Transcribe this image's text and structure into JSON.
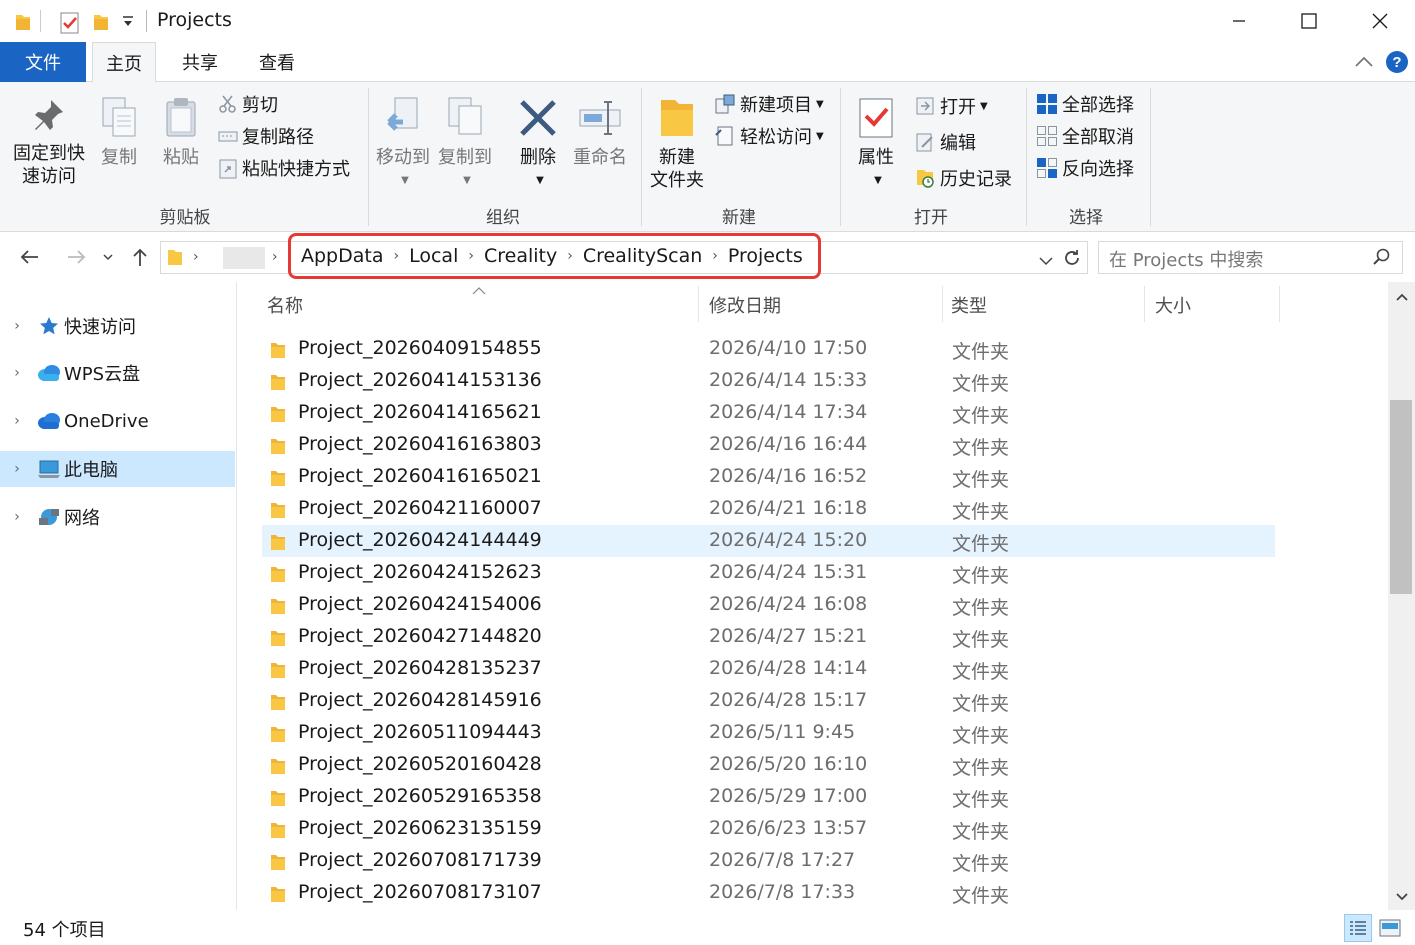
{
  "window": {
    "title": "Projects"
  },
  "ribbon_tabs": [
    "文件",
    "主页",
    "共享",
    "查看"
  ],
  "ribbon": {
    "clipboard": {
      "group": "剪贴板",
      "pin_line1": "固定到快",
      "pin_line2": "速访问",
      "copy": "复制",
      "paste": "粘贴",
      "cut": "剪切",
      "copy_path": "复制路径",
      "paste_shortcut": "粘贴快捷方式"
    },
    "organize": {
      "group": "组织",
      "move_to": "移动到",
      "copy_to": "复制到",
      "delete": "删除",
      "rename": "重命名"
    },
    "new": {
      "group": "新建",
      "new_folder_line1": "新建",
      "new_folder_line2": "文件夹",
      "new_item": "新建项目",
      "easy_access": "轻松访问"
    },
    "open": {
      "group": "打开",
      "properties": "属性",
      "open": "打开",
      "edit": "编辑",
      "history": "历史记录"
    },
    "select": {
      "group": "选择",
      "select_all": "全部选择",
      "select_none": "全部取消",
      "invert": "反向选择"
    }
  },
  "address": {
    "breadcrumbs": [
      "AppData",
      "Local",
      "Creality",
      "CrealityScan",
      "Projects"
    ],
    "search_placeholder": "在 Projects 中搜索"
  },
  "nav_pane": [
    {
      "label": "快速访问",
      "icon": "star-icon"
    },
    {
      "label": "WPS云盘",
      "icon": "cloud-icon"
    },
    {
      "label": "OneDrive",
      "icon": "onedrive-icon"
    },
    {
      "label": "此电脑",
      "icon": "computer-icon",
      "selected": true
    },
    {
      "label": "网络",
      "icon": "network-icon"
    }
  ],
  "columns": [
    "名称",
    "修改日期",
    "类型",
    "大小"
  ],
  "files": [
    {
      "name": "Project_20260409154855",
      "date": "2026/4/10 17:50",
      "type": "文件夹"
    },
    {
      "name": "Project_20260414153136",
      "date": "2026/4/14 15:33",
      "type": "文件夹"
    },
    {
      "name": "Project_20260414165621",
      "date": "2026/4/14 17:34",
      "type": "文件夹"
    },
    {
      "name": "Project_20260416163803",
      "date": "2026/4/16 16:44",
      "type": "文件夹"
    },
    {
      "name": "Project_20260416165021",
      "date": "2026/4/16 16:52",
      "type": "文件夹"
    },
    {
      "name": "Project_20260421160007",
      "date": "2026/4/21 16:18",
      "type": "文件夹"
    },
    {
      "name": "Project_20260424144449",
      "date": "2026/4/24 15:20",
      "type": "文件夹",
      "selected": true
    },
    {
      "name": "Project_20260424152623",
      "date": "2026/4/24 15:31",
      "type": "文件夹"
    },
    {
      "name": "Project_20260424154006",
      "date": "2026/4/24 16:08",
      "type": "文件夹"
    },
    {
      "name": "Project_20260427144820",
      "date": "2026/4/27 15:21",
      "type": "文件夹"
    },
    {
      "name": "Project_20260428135237",
      "date": "2026/4/28 14:14",
      "type": "文件夹"
    },
    {
      "name": "Project_20260428145916",
      "date": "2026/4/28 15:17",
      "type": "文件夹"
    },
    {
      "name": "Project_20260511094443",
      "date": "2026/5/11 9:45",
      "type": "文件夹"
    },
    {
      "name": "Project_20260520160428",
      "date": "2026/5/20 16:10",
      "type": "文件夹"
    },
    {
      "name": "Project_20260529165358",
      "date": "2026/5/29 17:00",
      "type": "文件夹"
    },
    {
      "name": "Project_20260623135159",
      "date": "2026/6/23 13:57",
      "type": "文件夹"
    },
    {
      "name": "Project_20260708171739",
      "date": "2026/7/8 17:27",
      "type": "文件夹"
    },
    {
      "name": "Project_20260708173107",
      "date": "2026/7/8 17:33",
      "type": "文件夹"
    }
  ],
  "status": {
    "item_count": "54 个项目"
  },
  "colors": {
    "accent": "#1a64c3",
    "selection": "#cce8ff",
    "row_selected": "#e5f3ff",
    "highlight_box": "#e53935",
    "folder": "#f8c845"
  }
}
